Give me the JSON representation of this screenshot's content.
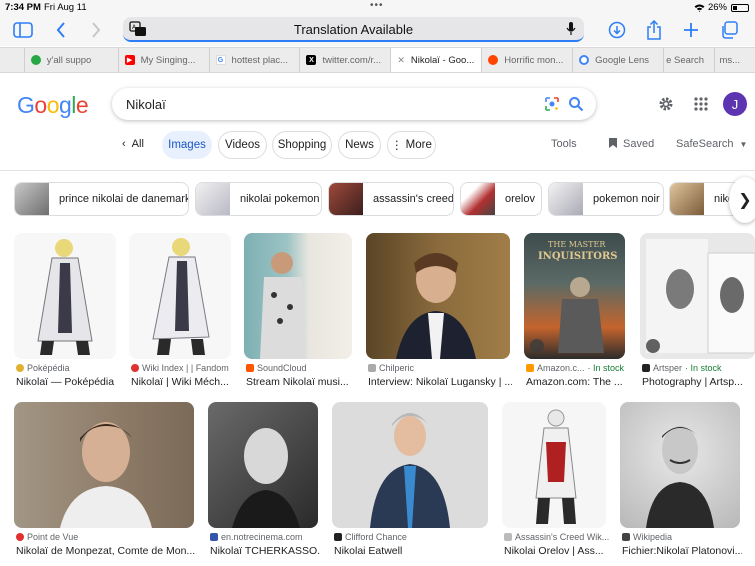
{
  "status": {
    "time": "7:34 PM",
    "date": "Fri Aug 11",
    "battery": "26%"
  },
  "toolbar": {
    "url_text": "Translation Available"
  },
  "tabs": [
    {
      "label": "y'all suppo",
      "color": "#27a745",
      "icon": "app-icon"
    },
    {
      "label": "My Singing...",
      "color": "#ff0000",
      "icon": "youtube-icon"
    },
    {
      "label": "hottest plac...",
      "color": "#4285f4",
      "icon": "google-icon"
    },
    {
      "label": "twitter.com/r...",
      "color": "#000000",
      "icon": "x-icon"
    },
    {
      "label": "Nikolaï - Goo...",
      "color": "#888888",
      "icon": "close-icon",
      "active": true
    },
    {
      "label": "Horrific mon...",
      "color": "#ff4500",
      "icon": "fire-icon"
    },
    {
      "label": "Google Lens",
      "color": "#4285f4",
      "icon": "lens-icon"
    },
    {
      "label": "e Search",
      "color": "#9aa0a6",
      "icon": ""
    },
    {
      "label": "ms...",
      "color": "#9aa0a6",
      "icon": ""
    }
  ],
  "google": {
    "query": "Nikolaï",
    "avatar_letter": "J",
    "logo": "Google"
  },
  "filters": {
    "back": "All",
    "chips": [
      "Images",
      "Videos",
      "Shopping",
      "News",
      "More"
    ],
    "tools": "Tools",
    "saved": "Saved",
    "safesearch": "SafeSearch"
  },
  "related": [
    {
      "label": "prince nikolai de danemark",
      "color": "#8a8a8a"
    },
    {
      "label": "nikolai pokemon",
      "color": "#c9c9d4"
    },
    {
      "label": "assassin's creed",
      "color": "#7b3b3b"
    },
    {
      "label": "orelov",
      "color": "#b23030"
    },
    {
      "label": "pokemon noir",
      "color": "#d0d0d8"
    },
    {
      "label": "niko",
      "color": "#c4a27c"
    }
  ],
  "results": [
    {
      "source": "Poképédia",
      "title": "Nikolaï — Poképédia",
      "color": "#f0f0f0",
      "accent": "#cccccc",
      "favicon": "#e0b030"
    },
    {
      "source": "Wiki Index | | Fandom",
      "title": "Nikolaï | Wiki Méch...",
      "color": "#f2f2f2",
      "accent": "#d8d8d8",
      "favicon": "#e03030"
    },
    {
      "source": "SoundCloud",
      "title": "Stream Nikolaï musi...",
      "color": "#7aa5a8",
      "accent": "#3f5a55",
      "favicon": "#ff5500"
    },
    {
      "source": "Chilperic",
      "title": "Interview: Nikolaï Lugansky | ...",
      "color": "#8b6b3d",
      "accent": "#1e2230",
      "favicon": "#aaaaaa"
    },
    {
      "source": "Amazon.c...",
      "stock": "In stock",
      "title": "Amazon.com: The ...",
      "color": "#4c5f5f",
      "accent": "#c4642c",
      "favicon": "#ff9900"
    },
    {
      "source": "Artsper",
      "stock": "In stock",
      "title": "Photography | Artsp...",
      "color": "#dcdcdc",
      "accent": "#7a7a7a",
      "favicon": "#222222"
    },
    {
      "source": "Point de Vue",
      "title": "Nikolaï de Monpezat, Comte de Mon...",
      "color": "#8c7a66",
      "accent": "#3b2a20",
      "favicon": "#e03030"
    },
    {
      "source": "en.notrecinema.com",
      "title": "Nikolaï TCHERKASSO...",
      "color": "#4a4a4a",
      "accent": "#1a1a1a",
      "favicon": "#3355aa"
    },
    {
      "source": "Clifford Chance",
      "title": "Nikolai Eatwell",
      "color": "#d8d8d8",
      "accent": "#2a3a55",
      "favicon": "#222222"
    },
    {
      "source": "Assassin's Creed Wik...",
      "title": "Nikolai Orelov | Ass...",
      "color": "#f4f4f4",
      "accent": "#b02020",
      "favicon": "#bbbbbb"
    },
    {
      "source": "Wikipedia",
      "title": "Fichier:Nikolaï Platonovi...",
      "color": "#d0d0d0",
      "accent": "#2a2a2a",
      "favicon": "#444444"
    }
  ]
}
